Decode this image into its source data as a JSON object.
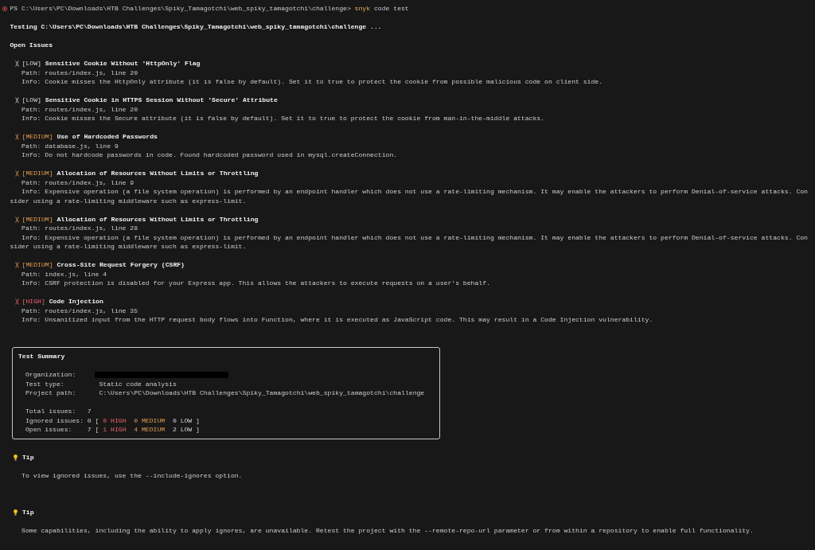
{
  "prompt": {
    "text": "PS C:\\Users\\PC\\Downloads\\HTB Challenges\\Spiky_Tamagotchi\\web_spiky_tamagotchi\\challenge>",
    "command": "snyk",
    "arguments": "code test"
  },
  "testing_line": "Testing C:\\Users\\PC\\Downloads\\HTB Challenges\\Spiky_Tamagotchi\\web_spiky_tamagotchi\\challenge ...",
  "open_issues": {
    "heading": "Open Issues",
    "issues": [
      {
        "kind": "low",
        "severity_label": "[LOW]",
        "title": "Sensitive Cookie Without 'HttpOnly' Flag",
        "path": "Path: routes/index.js, line 20",
        "info": "Info: Cookie misses the HttpOnly attribute (it is false by default). Set it to true to protect the cookie from possible malicious code on client side."
      },
      {
        "kind": "low",
        "severity_label": "[LOW]",
        "title": "Sensitive Cookie in HTTPS Session Without 'Secure' Attribute",
        "path": "Path: routes/index.js, line 20",
        "info": "Info: Cookie misses the Secure attribute (it is false by default). Set it to true to protect the cookie from man-in-the-middle attacks."
      },
      {
        "kind": "medium",
        "severity_label": "[MEDIUM]",
        "title": "Use of Hardcoded Passwords",
        "path": "Path: database.js, line 9",
        "info": "Info: Do not hardcode passwords in code. Found hardcoded password used in mysql.createConnection."
      },
      {
        "kind": "medium",
        "severity_label": "[MEDIUM]",
        "title": "Allocation of Resources Without Limits or Throttling",
        "path": "Path: routes/index.js, line 9",
        "info": "Info: Expensive operation (a file system operation) is performed by an endpoint handler which does not use a rate-limiting mechanism. It may enable the attackers to perform Denial-of-service attacks. Consider using a rate-limiting middleware such as express-limit."
      },
      {
        "kind": "medium",
        "severity_label": "[MEDIUM]",
        "title": "Allocation of Resources Without Limits or Throttling",
        "path": "Path: routes/index.js, line 28",
        "info": "Info: Expensive operation (a file system operation) is performed by an endpoint handler which does not use a rate-limiting mechanism. It may enable the attackers to perform Denial-of-service attacks. Consider using a rate-limiting middleware such as express-limit."
      },
      {
        "kind": "medium",
        "severity_label": "[MEDIUM]",
        "title": "Cross-Site Request Forgery (CSRF)",
        "path": "Path: index.js, line 4",
        "info": "Info: CSRF protection is disabled for your Express app. This allows the attackers to execute requests on a user's behalf."
      },
      {
        "kind": "high",
        "severity_label": "[HIGH]",
        "title": "Code Injection",
        "path": "Path: routes/index.js, line 35",
        "info": "Info: Unsanitized input from the HTTP request body flows into Function, where it is executed as JavaScript code. This may result in a Code Injection vulnerability."
      }
    ]
  },
  "test_summary": {
    "title": "Test Summary",
    "details": [
      {
        "label": "Organization:",
        "redacted": true
      },
      {
        "label": "Test type:",
        "value": "Static code analysis"
      },
      {
        "label": "Project path:",
        "value": "C:\\Users\\PC\\Downloads\\HTB Challenges\\Spiky_Tamagotchi\\web_spiky_tamagotchi\\challenge"
      }
    ],
    "counts": [
      {
        "label": "Total issues:",
        "total": "7"
      },
      {
        "label": "Ignored issues:",
        "total": "0",
        "open_bracket": "[",
        "breakdown": [
          {
            "kind": "high",
            "text": "0 HIGH"
          },
          {
            "kind": "medium",
            "text": "0 MEDIUM"
          },
          {
            "kind": "low",
            "text": "0 LOW"
          }
        ],
        "close_bracket": "]"
      },
      {
        "label": "Open issues:",
        "total": "7",
        "open_bracket": "[",
        "breakdown": [
          {
            "kind": "high",
            "text": "1 HIGH"
          },
          {
            "kind": "medium",
            "text": "4 MEDIUM"
          },
          {
            "kind": "low",
            "text": "2 LOW"
          }
        ],
        "close_bracket": "]"
      }
    ]
  },
  "tips": [
    {
      "title": "Tip",
      "text": "To view ignored issues, use the --include-ignores option."
    },
    {
      "title": "Tip",
      "text": "Some capabilities, including the ability to apply ignores, are unavailable. Retest the project with the --remote-repo-url parameter or from within a repository to enable full functionality."
    }
  ]
}
